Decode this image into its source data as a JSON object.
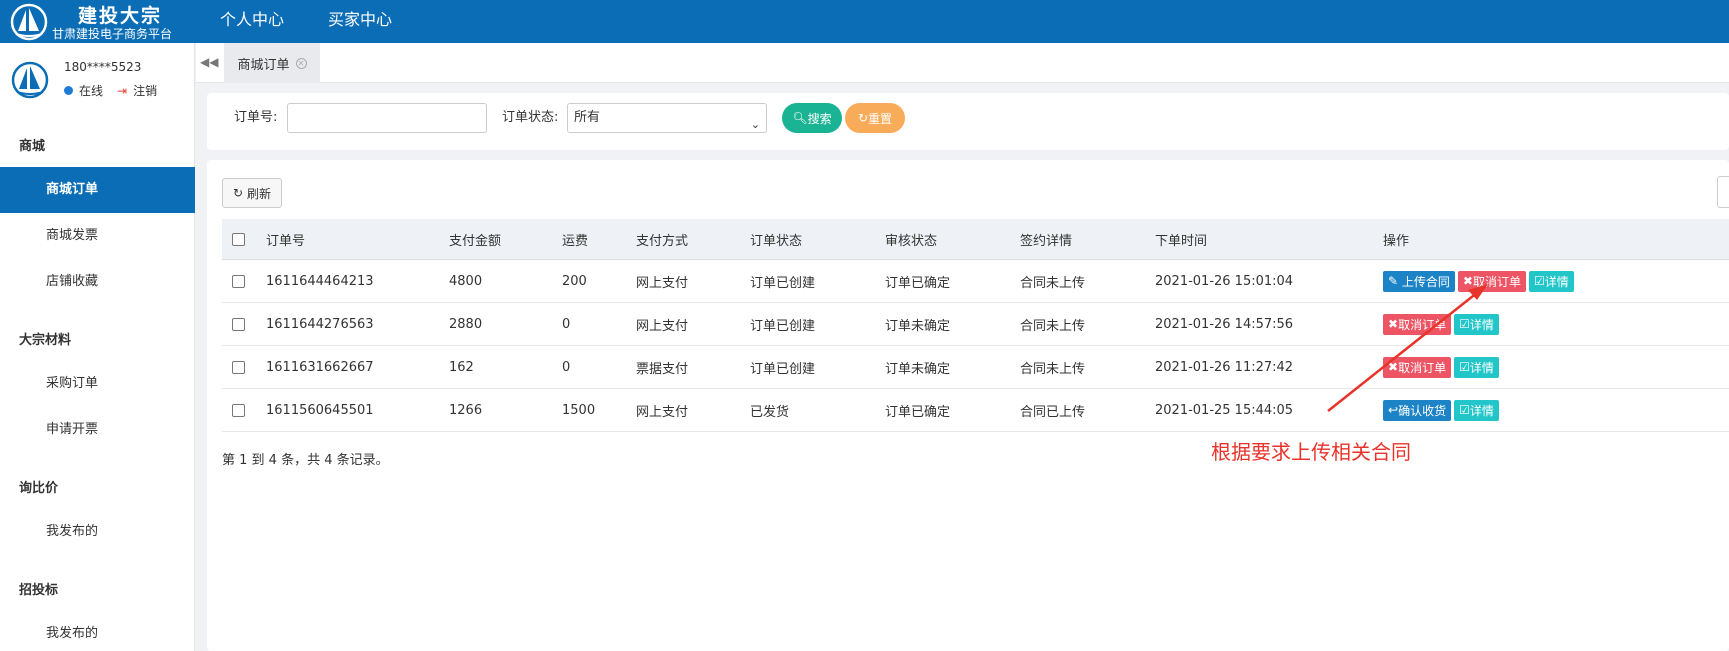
{
  "header": {
    "logo_title": "建投大宗",
    "logo_sub": "甘肃建投电子商务平台",
    "nav": [
      "个人中心",
      "买家中心"
    ]
  },
  "user": {
    "phone": "180****5523",
    "status": "在线",
    "logout": "注销"
  },
  "sidebar": {
    "groups": [
      {
        "label": "商城",
        "items": [
          "商城订单",
          "商城发票",
          "店铺收藏"
        ]
      },
      {
        "label": "大宗材料",
        "items": [
          "采购订单",
          "申请开票"
        ]
      },
      {
        "label": "询比价",
        "items": [
          "我发布的"
        ]
      },
      {
        "label": "招投标",
        "items": [
          "我发布的"
        ]
      }
    ],
    "active_item": "商城订单"
  },
  "tab": {
    "label": "商城订单"
  },
  "search": {
    "order_no_label": "订单号:",
    "order_no_value": "",
    "status_label": "订单状态:",
    "status_value": "所有",
    "search_btn": "搜索",
    "reset_btn": "重置"
  },
  "table": {
    "refresh_btn": "刷新",
    "columns": [
      "订单号",
      "支付金额",
      "运费",
      "支付方式",
      "订单状态",
      "审核状态",
      "签约详情",
      "下单时间",
      "操作"
    ],
    "rows": [
      {
        "order_no": "1611644464213",
        "amount": "4800",
        "freight": "200",
        "pay_method": "网上支付",
        "order_status": "订单已创建",
        "review_status": "订单已确定",
        "sign_detail": "合同未上传",
        "time": "2021-01-26 15:01:04",
        "actions": [
          "上传合同",
          "取消订单",
          "详情"
        ]
      },
      {
        "order_no": "1611644276563",
        "amount": "2880",
        "freight": "0",
        "pay_method": "网上支付",
        "order_status": "订单已创建",
        "review_status": "订单未确定",
        "sign_detail": "合同未上传",
        "time": "2021-01-26 14:57:56",
        "actions": [
          "取消订单",
          "详情"
        ]
      },
      {
        "order_no": "1611631662667",
        "amount": "162",
        "freight": "0",
        "pay_method": "票据支付",
        "order_status": "订单已创建",
        "review_status": "订单未确定",
        "sign_detail": "合同未上传",
        "time": "2021-01-26 11:27:42",
        "actions": [
          "取消订单",
          "详情"
        ]
      },
      {
        "order_no": "1611560645501",
        "amount": "1266",
        "freight": "1500",
        "pay_method": "网上支付",
        "order_status": "已发货",
        "review_status": "订单已确定",
        "sign_detail": "合同已上传",
        "time": "2021-01-25 15:44:05",
        "actions": [
          "确认收货",
          "详情"
        ]
      }
    ],
    "footer": "第 1 到 4 条，共 4 条记录。"
  },
  "annotation": "根据要求上传相关合同",
  "colors": {
    "primary": "#0b6db5",
    "green": "#1ab394",
    "orange": "#f8ac59",
    "red": "#ed5565",
    "teal": "#23c6c8",
    "annotation": "#e8332a"
  }
}
